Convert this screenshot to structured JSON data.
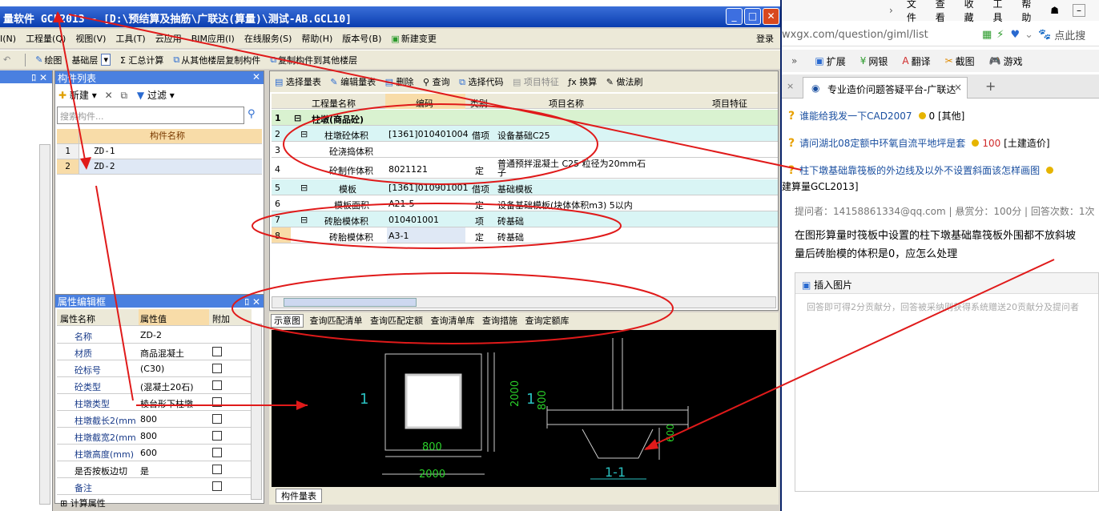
{
  "window": {
    "title": "量软件 GCL2013 - [D:\\预结算及抽筋\\广联达(算量)\\测试-AB.GCL10]",
    "login": "登录"
  },
  "menu": [
    "I(N)",
    "工程量(Q)",
    "视图(V)",
    "工具(T)",
    "云应用",
    "BIM应用(I)",
    "在线服务(S)",
    "帮助(H)",
    "版本号(B)",
    "新建变更"
  ],
  "toolbar2": [
    "绘图",
    "基础层",
    "Σ 汇总计算",
    "从其他楼层复制构件",
    "复制构件到其他楼层"
  ],
  "component_list": {
    "header": "构件列表",
    "new_btn": "新建",
    "filter_btn": "过滤",
    "search_placeholder": "搜索构件...",
    "col_header": "构件名称",
    "rows": [
      {
        "num": "1",
        "name": "ZD-1"
      },
      {
        "num": "2",
        "name": "ZD-2"
      }
    ]
  },
  "property_box": {
    "header": "属性编辑框",
    "cols": [
      "属性名称",
      "属性值",
      "附加"
    ],
    "rows": [
      {
        "k": "名称",
        "v": "ZD-2"
      },
      {
        "k": "材质",
        "v": "商品混凝土"
      },
      {
        "k": "砼标号",
        "v": "(C30)"
      },
      {
        "k": "砼类型",
        "v": "(混凝土20石)"
      },
      {
        "k": "柱墩类型",
        "v": "棱台形下柱墩"
      },
      {
        "k": "柱墩截长2(mm",
        "v": "800"
      },
      {
        "k": "柱墩截宽2(mm",
        "v": "800"
      },
      {
        "k": "柱墩高度(mm)",
        "v": "600"
      },
      {
        "k": "是否按板边切",
        "v": "是"
      },
      {
        "k": "备注",
        "v": ""
      }
    ],
    "footer": "计算属性"
  },
  "quantity": {
    "toolbar": [
      "选择量表",
      "编辑量表",
      "删除",
      "查询",
      "选择代码",
      "项目特征",
      "换算",
      "做法刷"
    ],
    "cols": [
      "工程量名称",
      "编码",
      "类别",
      "项目名称",
      "项目特征"
    ],
    "rows": [
      {
        "n": "1",
        "name": "柱墩(商品砼)",
        "code": "",
        "cat": "",
        "item": ""
      },
      {
        "n": "2",
        "name": "柱墩砼体积",
        "code": "[1361]010401004",
        "cat": "借项",
        "item": "设备基础C25"
      },
      {
        "n": "3",
        "name": "砼浇捣体积",
        "code": "",
        "cat": "",
        "item": ""
      },
      {
        "n": "4",
        "name": "砼制作体积",
        "code": "8021121",
        "cat": "定",
        "item": "普通预拌混凝土 C25 粒径为20mm石子"
      },
      {
        "n": "5",
        "name": "模板",
        "code": "[1361]010901001",
        "cat": "借项",
        "item": "基础模板"
      },
      {
        "n": "6",
        "name": "模板面积",
        "code": "A21-5",
        "cat": "定",
        "item": "设备基础模板(块体体积m3) 5以内"
      },
      {
        "n": "7",
        "name": "砖胎模体积",
        "code": "010401001",
        "cat": "项",
        "item": "砖基础"
      },
      {
        "n": "8",
        "name": "砖胎模体积",
        "code": "A3-1",
        "cat": "定",
        "item": "砖基础"
      }
    ],
    "tabs": [
      "示意图",
      "查询匹配清单",
      "查询匹配定额",
      "查询清单库",
      "查询措施",
      "查询定额库"
    ],
    "bottom_tab": "构件量表"
  },
  "schematic": {
    "label_left": "1",
    "label_mid": "1",
    "dim_inner": "800",
    "dim_side": "800",
    "dim_outer": "2000",
    "dim_outer_v": "2000",
    "dim_height": "600",
    "section": "1-1"
  },
  "browser": {
    "menu": [
      "文件",
      "查看",
      "收藏",
      "工具",
      "帮助"
    ],
    "url": "wxgx.com/question/giml/list",
    "url_right": "点此搜",
    "tools": [
      "扩展",
      "网银",
      "翻译",
      "截图",
      "游戏"
    ],
    "tab": "专业造价问题答疑平台-广联达",
    "questions": [
      {
        "text": "谁能给我发一下CAD2007",
        "coins": "0",
        "tag": "[其他]"
      },
      {
        "text": "请问湖北08定额中环氧自流平地坪是套",
        "coins": "100",
        "tag": "[土建造价]"
      },
      {
        "text": "柱下墩基础靠筏板的外边线及以外不设置斜面该怎样画图",
        "coins": "",
        "tag": ""
      }
    ],
    "q3_cont": "建算量GCL2013]",
    "meta": "提问者：14158861334@qq.com  |  悬赏分：100分  |  回答次数：1次",
    "body1": "在图形算量时筏板中设置的柱下墩基础靠筏板外围都不放斜坡",
    "body2": "量后砖胎模的体积是0，应怎么处理",
    "insert_img": "插入图片",
    "reply_placeholder": "回答即可得2分贡献分，回答被采纳则获得系统赠送20贡献分及提问者"
  }
}
